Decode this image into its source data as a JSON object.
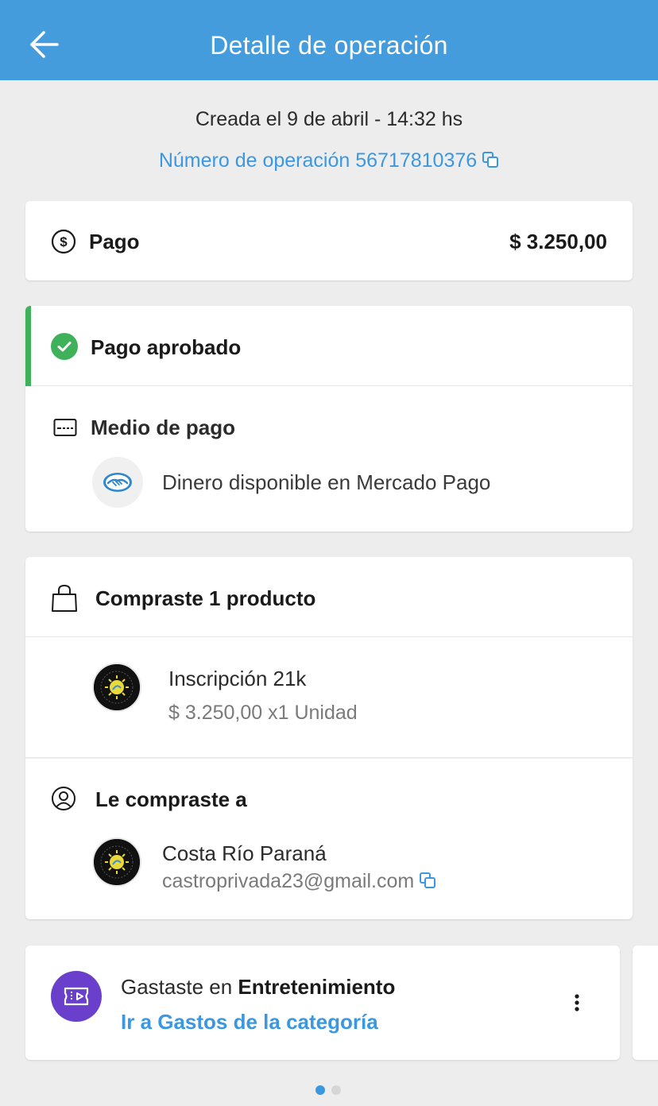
{
  "header": {
    "title": "Detalle de operación",
    "back_icon": "arrow-left-icon"
  },
  "operation": {
    "created": "Creada el 9 de abril - 14:32 hs",
    "number_text": "Número de operación 56717810376",
    "copy_icon": "copy-icon"
  },
  "payment": {
    "icon": "dollar-circle-icon",
    "label": "Pago",
    "amount": "$ 3.250,00"
  },
  "status": {
    "icon": "check-circle-icon",
    "label": "Pago aprobado",
    "accent_color": "#3fb15b"
  },
  "payment_method": {
    "icon": "card-icon",
    "label": "Medio de pago",
    "logo": "mercado-pago-logo",
    "description": "Dinero disponible en Mercado Pago"
  },
  "purchase": {
    "icon": "shopping-bag-icon",
    "title": "Compraste 1 producto",
    "product": {
      "name": "Inscripción 21k",
      "price_qty": "$ 3.250,00 x1 Unidad"
    }
  },
  "seller": {
    "icon": "user-circle-icon",
    "title": "Le compraste a",
    "name": "Costa Río Paraná",
    "email": "castroprivada23@gmail.com"
  },
  "spending": {
    "icon": "ticket-icon",
    "prefix": "Gastaste en ",
    "category": "Entretenimiento",
    "link": "Ir a Gastos de la categoría",
    "more_icon": "more-vertical-icon",
    "category_color": "#6a3fcb"
  },
  "carousel": {
    "active_index": 0,
    "count": 2
  },
  "colors": {
    "brand": "#459cdc",
    "link": "#3b98e0",
    "approved": "#3fb15b"
  }
}
